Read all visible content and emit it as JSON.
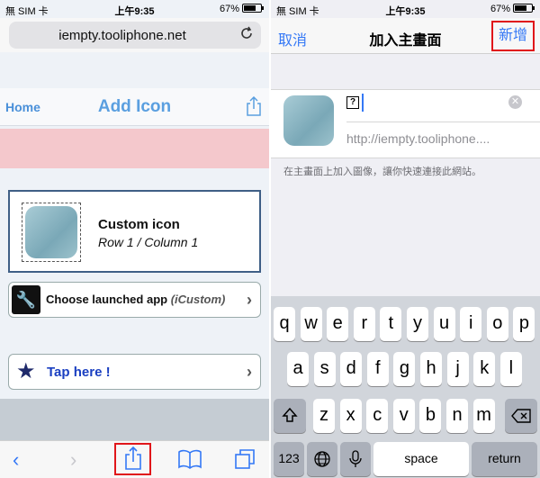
{
  "status_bar": {
    "carrier": "無 SIM 卡",
    "time": "上午9:35",
    "battery": "67%"
  },
  "safari": {
    "url": "iempty.tooliphone.net",
    "reload_icon": "reload-icon",
    "page": {
      "home_link": "Home",
      "title": "Add Icon",
      "icon_title": "Custom icon",
      "icon_position": "Row 1 / Column 1",
      "choose_app_label": "Choose launched app",
      "choose_app_name": "(iCustom)",
      "tap_label": "Tap here !"
    },
    "toolbar_icons": [
      "back-icon",
      "forward-icon",
      "share-icon",
      "bookmarks-icon",
      "tabs-icon"
    ]
  },
  "add_home": {
    "cancel": "取消",
    "title": "加入主畫面",
    "add": "新增",
    "name_value": "?",
    "url_value": "http://iempty.tooliphone....",
    "hint": "在主畫面上加入圖像，讓你快速連接此網站。"
  },
  "keyboard": {
    "row1": [
      "q",
      "w",
      "e",
      "r",
      "t",
      "y",
      "u",
      "i",
      "o",
      "p"
    ],
    "row2": [
      "a",
      "s",
      "d",
      "f",
      "g",
      "h",
      "j",
      "k",
      "l"
    ],
    "row3": [
      "z",
      "x",
      "c",
      "v",
      "b",
      "n",
      "m"
    ],
    "shift_icon": "shift-icon",
    "delete_icon": "delete-icon",
    "numbers": "123",
    "globe_icon": "globe-icon",
    "mic_icon": "mic-icon",
    "space": "space",
    "return": "return"
  },
  "colors": {
    "accent": "#3478f6",
    "highlight": "#e0161a",
    "web_title": "#5a9fe0",
    "tap_text": "#1a3fc1"
  }
}
